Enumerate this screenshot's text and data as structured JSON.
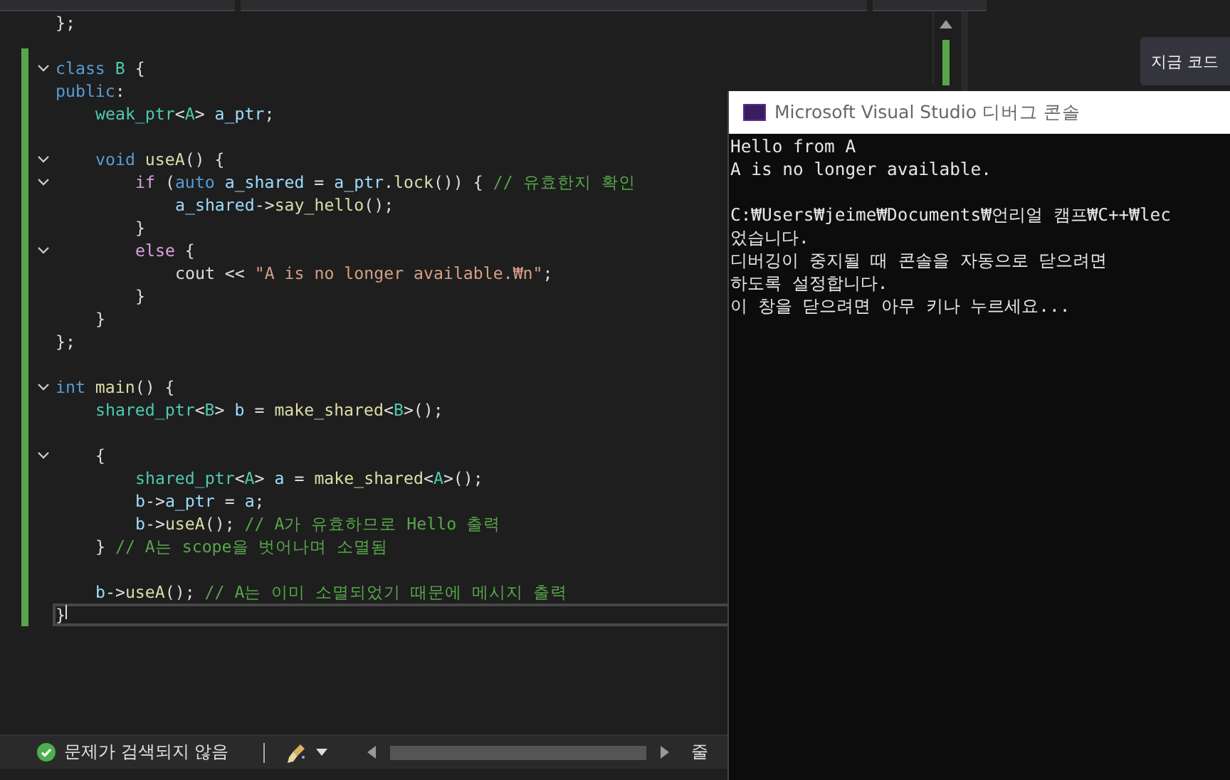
{
  "editor": {
    "lines": [
      {
        "kind": "code",
        "fold": false,
        "current": false,
        "tokens": [
          {
            "kind": "plain",
            "text": "};"
          }
        ]
      },
      {
        "kind": "blank"
      },
      {
        "kind": "code",
        "fold": true,
        "current": false,
        "tokens": [
          {
            "kind": "kw",
            "text": "class "
          },
          {
            "kind": "type",
            "text": "B"
          },
          {
            "kind": "plain",
            "text": " {"
          }
        ]
      },
      {
        "kind": "code",
        "fold": false,
        "current": false,
        "tokens": [
          {
            "kind": "kw",
            "text": "public"
          },
          {
            "kind": "plain",
            "text": ":"
          }
        ],
        "children": [
          {
            "kind": "code",
            "fold": false,
            "current": false,
            "tokens": [
              {
                "kind": "type",
                "text": "weak_ptr"
              },
              {
                "kind": "plain",
                "text": "<"
              },
              {
                "kind": "type",
                "text": "A"
              },
              {
                "kind": "plain",
                "text": "> "
              },
              {
                "kind": "var",
                "text": "a_ptr"
              },
              {
                "kind": "plain",
                "text": ";"
              }
            ]
          },
          {
            "kind": "blank"
          },
          {
            "kind": "code",
            "fold": true,
            "current": false,
            "tokens": [
              {
                "kind": "kw",
                "text": "void "
              },
              {
                "kind": "fn",
                "text": "useA"
              },
              {
                "kind": "plain",
                "text": "() {"
              }
            ],
            "children": [
              {
                "kind": "code",
                "fold": true,
                "current": false,
                "tokens": [
                  {
                    "kind": "ctl",
                    "text": "if"
                  },
                  {
                    "kind": "plain",
                    "text": " ("
                  },
                  {
                    "kind": "kw",
                    "text": "auto "
                  },
                  {
                    "kind": "var",
                    "text": "a_shared"
                  },
                  {
                    "kind": "plain",
                    "text": " = "
                  },
                  {
                    "kind": "var",
                    "text": "a_ptr"
                  },
                  {
                    "kind": "plain",
                    "text": "."
                  },
                  {
                    "kind": "fn",
                    "text": "lock"
                  },
                  {
                    "kind": "plain",
                    "text": "()) { "
                  },
                  {
                    "kind": "comment",
                    "text": "// 유효한지 확인"
                  }
                ],
                "children": [
                  {
                    "kind": "code",
                    "fold": false,
                    "current": false,
                    "tokens": [
                      {
                        "kind": "var",
                        "text": "a_shared"
                      },
                      {
                        "kind": "plain",
                        "text": "->"
                      },
                      {
                        "kind": "fn",
                        "text": "say_hello"
                      },
                      {
                        "kind": "plain",
                        "text": "();"
                      }
                    ]
                  }
                ]
              },
              {
                "kind": "code",
                "fold": false,
                "current": false,
                "tokens": [
                  {
                    "kind": "plain",
                    "text": "}"
                  }
                ]
              },
              {
                "kind": "code",
                "fold": true,
                "current": false,
                "tokens": [
                  {
                    "kind": "ctl",
                    "text": "else"
                  },
                  {
                    "kind": "plain",
                    "text": " {"
                  }
                ],
                "children": [
                  {
                    "kind": "code",
                    "fold": false,
                    "current": false,
                    "tokens": [
                      {
                        "kind": "plain",
                        "text": "cout << "
                      },
                      {
                        "kind": "str",
                        "text": "\"A is no longer available.₩n\""
                      },
                      {
                        "kind": "plain",
                        "text": ";"
                      }
                    ]
                  }
                ]
              },
              {
                "kind": "code",
                "fold": false,
                "current": false,
                "tokens": [
                  {
                    "kind": "plain",
                    "text": "}"
                  }
                ]
              }
            ]
          },
          {
            "kind": "code",
            "fold": false,
            "current": false,
            "tokens": [
              {
                "kind": "plain",
                "text": "}"
              }
            ]
          }
        ]
      },
      {
        "kind": "code",
        "fold": false,
        "current": false,
        "tokens": [
          {
            "kind": "plain",
            "text": "};"
          }
        ]
      },
      {
        "kind": "blank"
      },
      {
        "kind": "code",
        "fold": true,
        "current": false,
        "tokens": [
          {
            "kind": "kw",
            "text": "int "
          },
          {
            "kind": "fn",
            "text": "main"
          },
          {
            "kind": "plain",
            "text": "() {"
          }
        ],
        "children": [
          {
            "kind": "code",
            "fold": false,
            "current": false,
            "tokens": [
              {
                "kind": "type",
                "text": "shared_ptr"
              },
              {
                "kind": "plain",
                "text": "<"
              },
              {
                "kind": "type",
                "text": "B"
              },
              {
                "kind": "plain",
                "text": "> "
              },
              {
                "kind": "var",
                "text": "b"
              },
              {
                "kind": "plain",
                "text": " = "
              },
              {
                "kind": "fn",
                "text": "make_shared"
              },
              {
                "kind": "plain",
                "text": "<"
              },
              {
                "kind": "type",
                "text": "B"
              },
              {
                "kind": "plain",
                "text": ">();"
              }
            ]
          },
          {
            "kind": "blank"
          },
          {
            "kind": "code",
            "fold": true,
            "current": false,
            "tokens": [
              {
                "kind": "plain",
                "text": "{"
              }
            ],
            "children": [
              {
                "kind": "code",
                "fold": false,
                "current": false,
                "tokens": [
                  {
                    "kind": "type",
                    "text": "shared_ptr"
                  },
                  {
                    "kind": "plain",
                    "text": "<"
                  },
                  {
                    "kind": "type",
                    "text": "A"
                  },
                  {
                    "kind": "plain",
                    "text": "> "
                  },
                  {
                    "kind": "var",
                    "text": "a"
                  },
                  {
                    "kind": "plain",
                    "text": " = "
                  },
                  {
                    "kind": "fn",
                    "text": "make_shared"
                  },
                  {
                    "kind": "plain",
                    "text": "<"
                  },
                  {
                    "kind": "type",
                    "text": "A"
                  },
                  {
                    "kind": "plain",
                    "text": ">();"
                  }
                ]
              },
              {
                "kind": "code",
                "fold": false,
                "current": false,
                "tokens": [
                  {
                    "kind": "var",
                    "text": "b"
                  },
                  {
                    "kind": "plain",
                    "text": "->"
                  },
                  {
                    "kind": "var",
                    "text": "a_ptr"
                  },
                  {
                    "kind": "plain",
                    "text": " = "
                  },
                  {
                    "kind": "var",
                    "text": "a"
                  },
                  {
                    "kind": "plain",
                    "text": ";"
                  }
                ]
              },
              {
                "kind": "code",
                "fold": false,
                "current": false,
                "tokens": [
                  {
                    "kind": "var",
                    "text": "b"
                  },
                  {
                    "kind": "plain",
                    "text": "->"
                  },
                  {
                    "kind": "fn",
                    "text": "useA"
                  },
                  {
                    "kind": "plain",
                    "text": "(); "
                  },
                  {
                    "kind": "comment",
                    "text": "// A가 유효하므로 Hello 출력"
                  }
                ]
              }
            ]
          },
          {
            "kind": "code",
            "fold": false,
            "current": false,
            "tokens": [
              {
                "kind": "plain",
                "text": "} "
              },
              {
                "kind": "comment",
                "text": "// A는 scope을 벗어나며 소멸됨"
              }
            ]
          },
          {
            "kind": "blank"
          },
          {
            "kind": "code",
            "fold": false,
            "current": false,
            "tokens": [
              {
                "kind": "var",
                "text": "b"
              },
              {
                "kind": "plain",
                "text": "->"
              },
              {
                "kind": "fn",
                "text": "useA"
              },
              {
                "kind": "plain",
                "text": "(); "
              },
              {
                "kind": "comment",
                "text": "// A는 이미 소멸되었기 때문에 메시지 출력"
              }
            ]
          }
        ]
      },
      {
        "kind": "code",
        "fold": false,
        "current": true,
        "tokens": [
          {
            "kind": "plain",
            "text": "}"
          }
        ]
      }
    ]
  },
  "side_panel": {
    "button": "지금 코드"
  },
  "console": {
    "title": "Microsoft Visual Studio 디버그 콘솔",
    "output": [
      "Hello from A",
      "A is no longer available."
    ],
    "message": [
      "C:₩Users₩jeime₩Documents₩언리얼 캠프₩C++₩lec",
      "었습니다.",
      "디버깅이 중지될 때 콘솔을 자동으로 닫으려면",
      "하도록 설정합니다.",
      "이 창을 닫으려면 아무 키나 누르세요..."
    ]
  },
  "status_bar": {
    "issues": "문제가 검색되지 않음",
    "line_label": "줄"
  }
}
